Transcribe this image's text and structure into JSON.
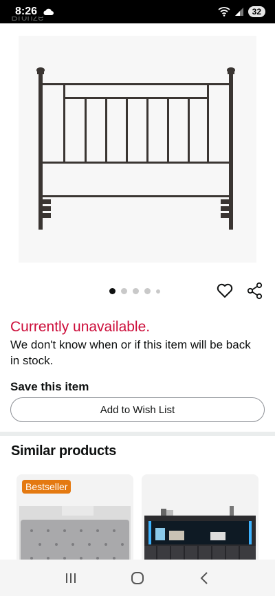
{
  "status_bar": {
    "time": "8:26",
    "battery": "32"
  },
  "product": {
    "color_name_cut": "Bronze",
    "image_alt": "Metal headboard",
    "gallery_count": 5,
    "gallery_active_index": 0
  },
  "availability": {
    "status": "Currently unavailable.",
    "message": "We don't know when or if this item will be back in stock."
  },
  "save": {
    "title": "Save this item",
    "wishlist_label": "Add to Wish List"
  },
  "similar": {
    "title": "Similar products",
    "items": [
      {
        "badge": "Bestseller"
      },
      {
        "badge": ""
      }
    ]
  },
  "colors": {
    "unavailable_red": "#cc0c39",
    "bestseller_orange": "#e47911",
    "frame_bronze": "#3a3532"
  }
}
